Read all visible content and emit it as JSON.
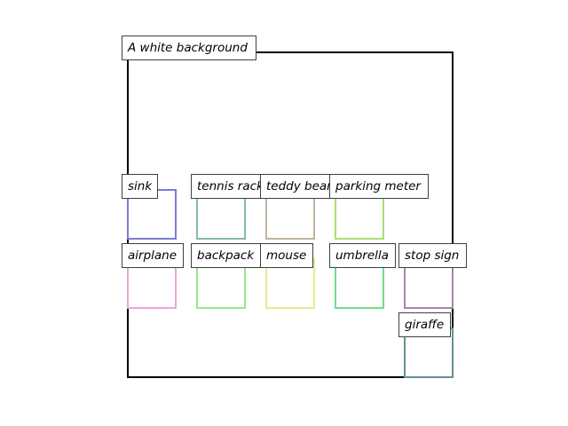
{
  "title": "A white background",
  "frame_color": "#000000",
  "objects": [
    {
      "label": "sink",
      "color": "#7b7bd8"
    },
    {
      "label": "tennis racket",
      "color": "#86b8b0"
    },
    {
      "label": "teddy bear",
      "color": "#c0b49c"
    },
    {
      "label": "parking meter",
      "color": "#a8e070"
    },
    {
      "label": "airplane",
      "color": "#eea4d8"
    },
    {
      "label": "backpack",
      "color": "#94e88c"
    },
    {
      "label": "mouse",
      "color": "#ece88c"
    },
    {
      "label": "umbrella",
      "color": "#72de84"
    },
    {
      "label": "stop sign",
      "color": "#a886ac"
    },
    {
      "label": "giraffe",
      "color": "#5f9396"
    }
  ]
}
